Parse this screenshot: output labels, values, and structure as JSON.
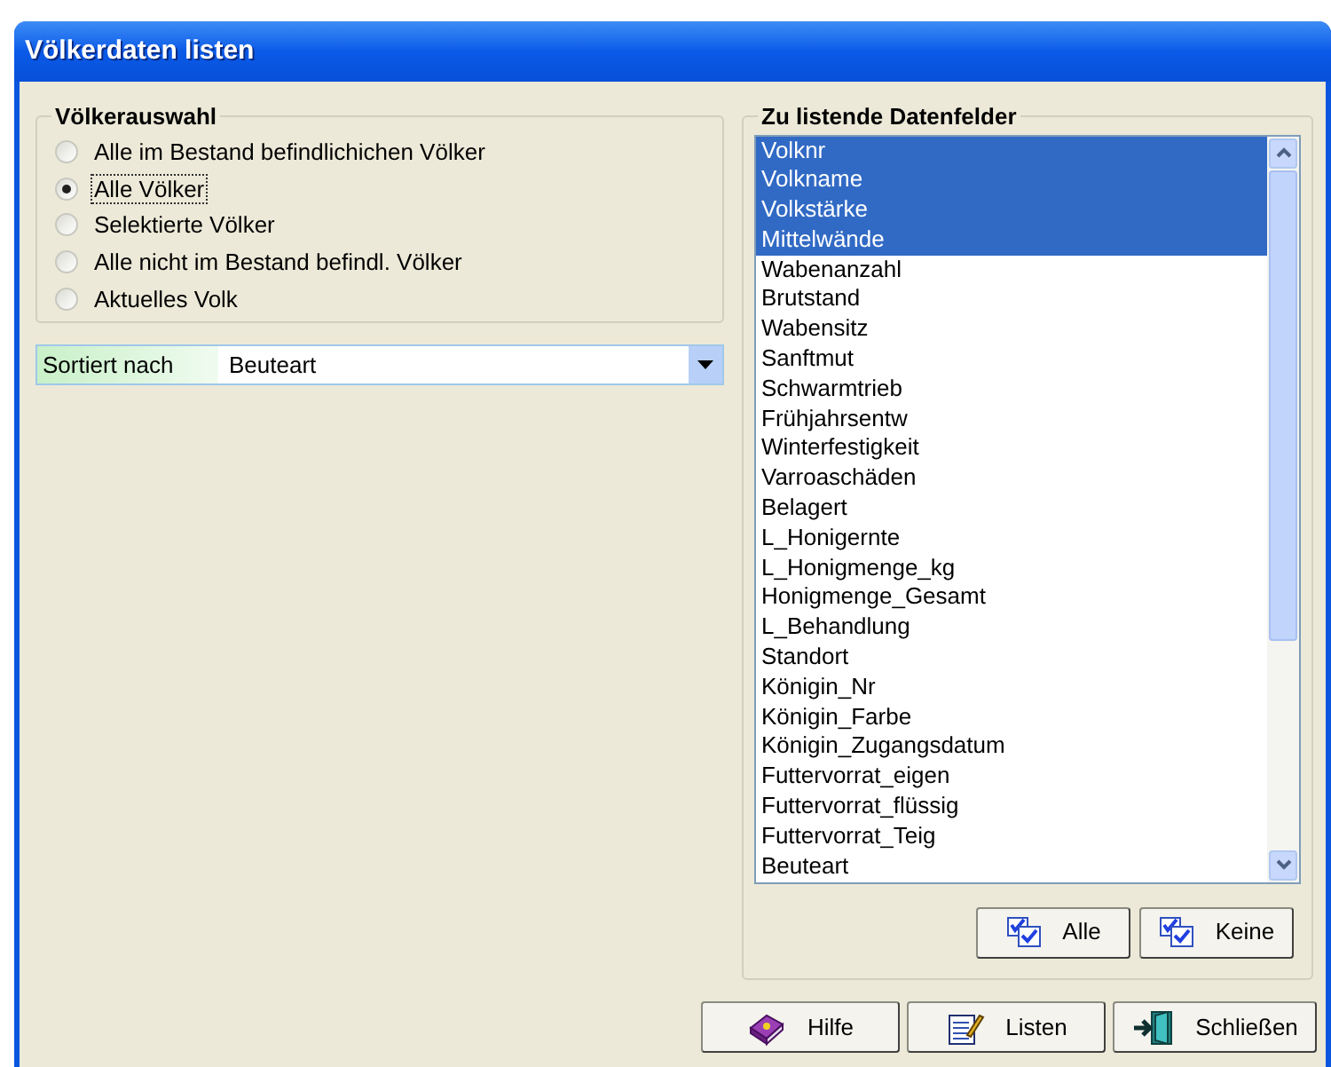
{
  "window": {
    "title": "Völkerdaten listen"
  },
  "selection_group": {
    "title": "Völkerauswahl",
    "options": [
      {
        "label": "Alle im Bestand befindlichichen Völker",
        "selected": false,
        "focused": false
      },
      {
        "label": "Alle Völker",
        "selected": true,
        "focused": true
      },
      {
        "label": "Selektierte Völker",
        "selected": false,
        "focused": false
      },
      {
        "label": "Alle nicht im Bestand befindl. Völker",
        "selected": false,
        "focused": false
      },
      {
        "label": "Aktuelles Volk",
        "selected": false,
        "focused": false
      }
    ]
  },
  "sort": {
    "label": "Sortiert nach",
    "value": "Beuteart"
  },
  "fields_group": {
    "title": "Zu listende Datenfelder",
    "items": [
      {
        "label": "Volknr",
        "selected": true
      },
      {
        "label": "Volkname",
        "selected": true
      },
      {
        "label": "Volkstärke",
        "selected": true
      },
      {
        "label": "Mittelwände",
        "selected": true
      },
      {
        "label": "Wabenanzahl",
        "selected": false
      },
      {
        "label": "Brutstand",
        "selected": false
      },
      {
        "label": "Wabensitz",
        "selected": false
      },
      {
        "label": "Sanftmut",
        "selected": false
      },
      {
        "label": "Schwarmtrieb",
        "selected": false
      },
      {
        "label": "Frühjahrsentw",
        "selected": false
      },
      {
        "label": "Winterfestigkeit",
        "selected": false
      },
      {
        "label": "Varroaschäden",
        "selected": false
      },
      {
        "label": "Belagert",
        "selected": false
      },
      {
        "label": "L_Honigernte",
        "selected": false
      },
      {
        "label": "L_Honigmenge_kg",
        "selected": false
      },
      {
        "label": "Honigmenge_Gesamt",
        "selected": false
      },
      {
        "label": "L_Behandlung",
        "selected": false
      },
      {
        "label": "Standort",
        "selected": false
      },
      {
        "label": "Königin_Nr",
        "selected": false
      },
      {
        "label": "Königin_Farbe",
        "selected": false
      },
      {
        "label": "Königin_Zugangsdatum",
        "selected": false
      },
      {
        "label": "Futtervorrat_eigen",
        "selected": false
      },
      {
        "label": "Futtervorrat_flüssig",
        "selected": false
      },
      {
        "label": "Futtervorrat_Teig",
        "selected": false
      },
      {
        "label": "Beuteart",
        "selected": false
      }
    ],
    "buttons": [
      {
        "label": "Alle",
        "kind": "checkboxes"
      },
      {
        "label": "Keine",
        "kind": "checkboxes"
      }
    ]
  },
  "buttons": [
    {
      "label": "Hilfe",
      "kind": "help"
    },
    {
      "label": "Listen",
      "kind": "list"
    },
    {
      "label": "Schließen",
      "kind": "close"
    }
  ]
}
